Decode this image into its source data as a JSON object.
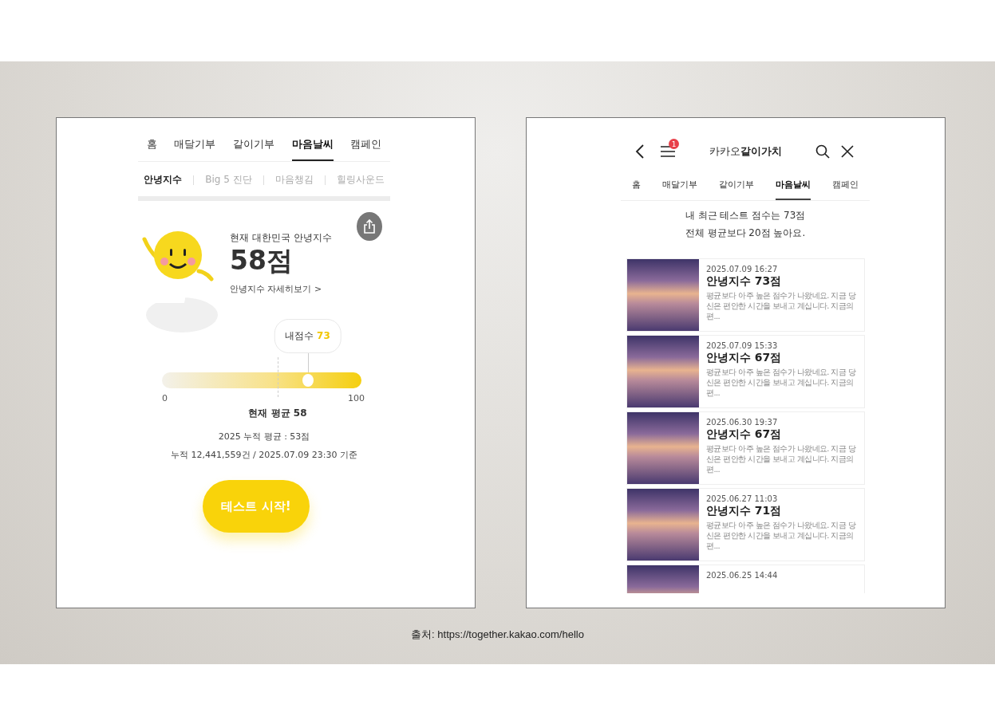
{
  "left": {
    "main_tabs": [
      {
        "label": "홈",
        "selected": false
      },
      {
        "label": "매달기부",
        "selected": false
      },
      {
        "label": "같이기부",
        "selected": false
      },
      {
        "label": "마음날씨",
        "selected": true
      },
      {
        "label": "캠페인",
        "selected": false
      }
    ],
    "sub_tabs": [
      {
        "label": "안녕지수",
        "selected": true
      },
      {
        "label": "Big 5 진단",
        "selected": false
      },
      {
        "label": "마음챙김",
        "selected": false
      },
      {
        "label": "힐링사운드",
        "selected": false
      }
    ],
    "index_label": "현재 대한민국 안녕지수",
    "index_value": "58점",
    "detail_link": "안녕지수 자세히보기 >",
    "my_score": {
      "label": "내점수",
      "value": "73",
      "level": 0.73
    },
    "average": {
      "label": "현재 평균 58",
      "level": 0.58
    },
    "scale_min": "0",
    "scale_max": "100",
    "stats": [
      "2025 누적 평균 : 53점",
      "누적 12,441,559건 / 2025.07.09 23:30 기준"
    ],
    "start_button": "테스트 시작!"
  },
  "right": {
    "title": "카카오**같이가치**",
    "menu_badge": "1",
    "tabs": [
      {
        "label": "홈",
        "selected": false
      },
      {
        "label": "매달기부",
        "selected": false
      },
      {
        "label": "같이기부",
        "selected": false
      },
      {
        "label": "마음날씨",
        "selected": true
      },
      {
        "label": "캠페인",
        "selected": false
      }
    ],
    "summary": [
      "내 최근 테스트 점수는 73점",
      "전체 평균보다 20점 높아요."
    ],
    "results": [
      {
        "date": "2025.07.09 16:27",
        "title": "안녕지수 73점",
        "description": "평균보다 아주 높은 점수가 나왔네요. 지금 당신은 편안한 시간을 보내고 계십니다. 지금의 편..."
      },
      {
        "date": "2025.07.09 15:33",
        "title": "안녕지수 67점",
        "description": "평균보다 아주 높은 점수가 나왔네요. 지금 당신은 편안한 시간을 보내고 계십니다. 지금의 편..."
      },
      {
        "date": "2025.06.30 19:37",
        "title": "안녕지수 67점",
        "description": "평균보다 아주 높은 점수가 나왔네요. 지금 당신은 편안한 시간을 보내고 계십니다. 지금의 편..."
      },
      {
        "date": "2025.06.27 11:03",
        "title": "안녕지수 71점",
        "description": "평균보다 아주 높은 점수가 나왔네요. 지금 당신은 편안한 시간을 보내고 계십니다. 지금의 편..."
      },
      {
        "date": "2025.06.25 14:44"
      }
    ]
  },
  "caption": "출처: https://together.kakao.com/hello"
}
